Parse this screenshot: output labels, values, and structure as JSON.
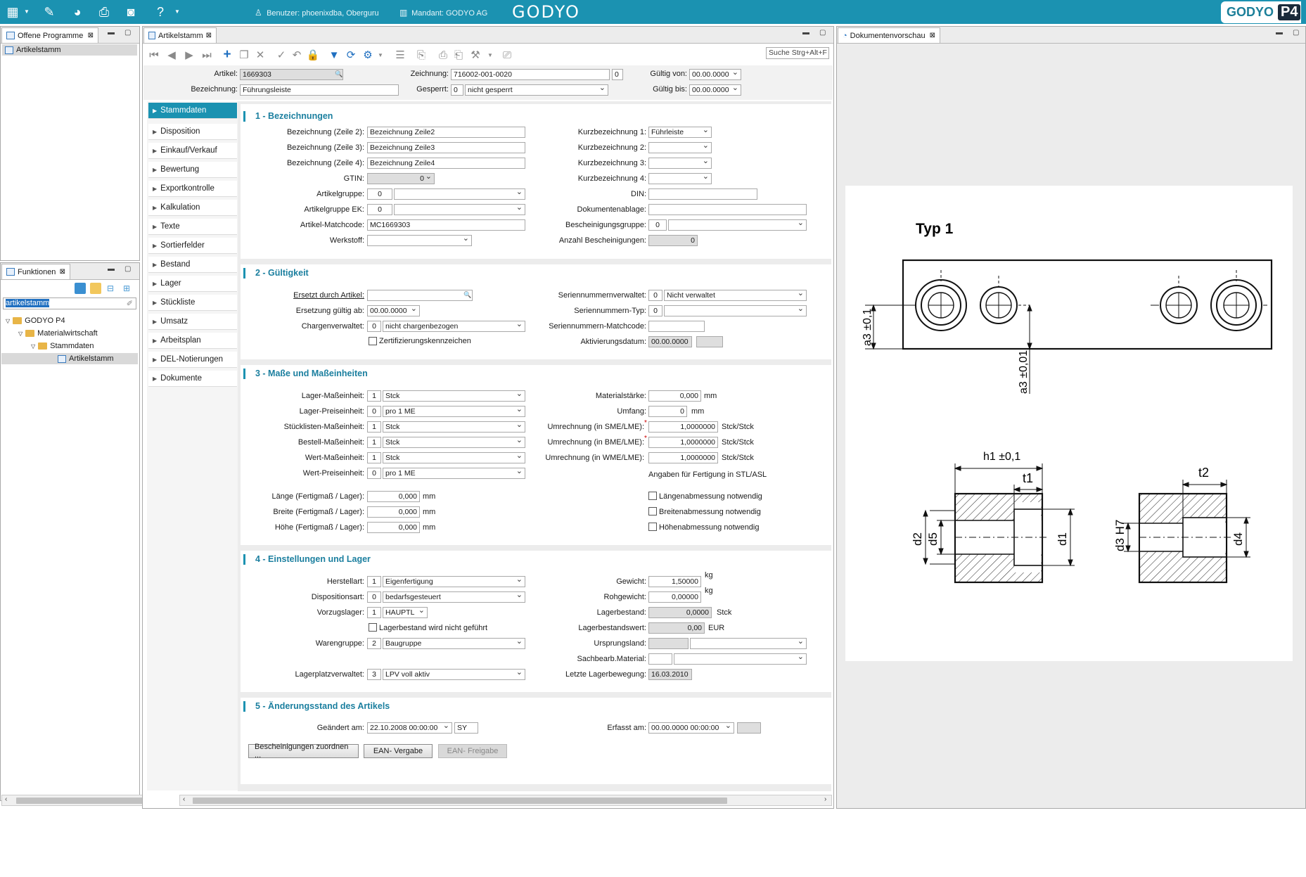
{
  "topbar": {
    "user_label": "Benutzer: phoenixdba, Oberguru",
    "client_label": "Mandant: GODYO AG",
    "logo_center": "GODYO",
    "logo_right": "GODYO",
    "logo_p4": "P4"
  },
  "left_panel": {
    "tab": "Offene Programme",
    "items": [
      "Artikelstamm"
    ]
  },
  "functions_panel": {
    "tab": "Funktionen",
    "search_value": "artikelstamm",
    "tree": [
      "GODYO P4",
      "Materialwirtschaft",
      "Stammdaten",
      "Artikelstamm"
    ]
  },
  "main": {
    "tab": "Artikelstamm",
    "search_placeholder": "Suche Strg+Alt+F",
    "header": {
      "artikel_label": "Artikel:",
      "artikel_value": "1669303",
      "bezeichnung_label": "Bezeichnung:",
      "bezeichnung_value": "Führungsleiste",
      "zeichnung_label": "Zeichnung:",
      "zeichnung_value": "716002-001-0020",
      "zeichnung_idx": "0",
      "gesperrt_label": "Gesperrt:",
      "gesperrt_code": "0",
      "gesperrt_value": "nicht gesperrt",
      "gueltig_von_label": "Gültig von:",
      "gueltig_von_value": "00.00.0000",
      "gueltig_bis_label": "Gültig bis:",
      "gueltig_bis_value": "00.00.0000"
    },
    "nav": [
      "Stammdaten",
      "Disposition",
      "Einkauf/Verkauf",
      "Bewertung",
      "Exportkontrolle",
      "Kalkulation",
      "Texte",
      "Sortierfelder",
      "Bestand",
      "Lager",
      "Stückliste",
      "Umsatz",
      "Arbeitsplan",
      "DEL-Notierungen",
      "Dokumente"
    ],
    "s1": {
      "title": "1 - Bezeichnungen",
      "bz2_l": "Bezeichnung (Zeile 2):",
      "bz2_v": "Bezeichnung Zeile2",
      "bz3_l": "Bezeichnung (Zeile 3):",
      "bz3_v": "Bezeichnung Zeile3",
      "bz4_l": "Bezeichnung (Zeile 4):",
      "bz4_v": "Bezeichnung Zeile4",
      "gtin_l": "GTIN:",
      "gtin_v": "0",
      "ag_l": "Artikelgruppe:",
      "ag_v": "0",
      "agek_l": "Artikelgruppe EK:",
      "agek_v": "0",
      "mc_l": "Artikel-Matchcode:",
      "mc_v": "MC1669303",
      "ws_l": "Werkstoff:",
      "kb1_l": "Kurzbezeichnung 1:",
      "kb1_v": "Führleiste",
      "kb2_l": "Kurzbezeichnung 2:",
      "kb3_l": "Kurzbezeichnung 3:",
      "kb4_l": "Kurzbezeichnung 4:",
      "din_l": "DIN:",
      "dok_l": "Dokumentenablage:",
      "bg_l": "Bescheinigungsgruppe:",
      "bg_v": "0",
      "ab_l": "Anzahl Bescheinigungen:",
      "ab_v": "0"
    },
    "s2": {
      "title": "2 - Gültigkeit",
      "ersetzt_l": "Ersetzt durch Artikel:",
      "ersetz_ab_l": "Ersetzung gültig ab:",
      "ersetz_ab_v": "00.00.0000",
      "charge_l": "Chargenverwaltet:",
      "charge_code": "0",
      "charge_v": "nicht chargenbezogen",
      "zert_l": "Zertifizierungskennzeichen",
      "snv_l": "Seriennummernverwaltet:",
      "snv_code": "0",
      "snv_v": "Nicht verwaltet",
      "snt_l": "Seriennummern-Typ:",
      "snt_v": "0",
      "snm_l": "Seriennummern-Matchcode:",
      "akt_l": "Aktivierungsdatum:",
      "akt_v": "00.00.0000"
    },
    "s3": {
      "title": "3 - Maße und Maßeinheiten",
      "lme_l": "Lager-Maßeinheit:",
      "lme_c": "1",
      "lme_v": "Stck",
      "lpe_l": "Lager-Preiseinheit:",
      "lpe_c": "0",
      "lpe_v": "pro 1 ME",
      "sme_l": "Stücklisten-Maßeinheit:",
      "sme_c": "1",
      "sme_v": "Stck",
      "bme_l": "Bestell-Maßeinheit:",
      "bme_c": "1",
      "bme_v": "Stck",
      "wme_l": "Wert-Maßeinheit:",
      "wme_c": "1",
      "wme_v": "Stck",
      "wpe_l": "Wert-Preiseinheit:",
      "wpe_c": "0",
      "wpe_v": "pro 1 ME",
      "laenge_l": "Länge (Fertigmaß / Lager):",
      "laenge_v": "0,000",
      "breite_l": "Breite (Fertigmaß / Lager):",
      "breite_v": "0,000",
      "hoehe_l": "Höhe (Fertigmaß / Lager):",
      "hoehe_v": "0,000",
      "unit_mm": "mm",
      "ms_l": "Materialstärke:",
      "ms_v": "0,000",
      "umf_l": "Umfang:",
      "umf_v": "0",
      "u_sme_l": "Umrechnung (in SME/LME):",
      "u_sme_v": "1,0000000",
      "u_bme_l": "Umrechnung (in BME/LME):",
      "u_bme_v": "1,0000000",
      "u_wme_l": "Umrechnung (in WME/LME):",
      "u_wme_v": "1,0000000",
      "unit_stck": "Stck/Stck",
      "fert_l": "Angaben für Fertigung in STL/ASL",
      "cb1": "Längenabmessung notwendig",
      "cb2": "Breitenabmessung notwendig",
      "cb3": "Höhenabmessung notwendig"
    },
    "s4": {
      "title": "4 - Einstellungen und Lager",
      "ha_l": "Herstellart:",
      "ha_c": "1",
      "ha_v": "Eigenfertigung",
      "da_l": "Dispositionsart:",
      "da_c": "0",
      "da_v": "bedarfsgesteuert",
      "vl_l": "Vorzugslager:",
      "vl_c": "1",
      "vl_v": "HAUPTL",
      "lb_cb": "Lagerbestand wird nicht geführt",
      "wg_l": "Warengruppe:",
      "wg_c": "2",
      "wg_v": "Baugruppe",
      "lpv_l": "Lagerplatzverwaltet:",
      "lpv_c": "3",
      "lpv_v": "LPV voll aktiv",
      "gew_l": "Gewicht:",
      "gew_v": "1,50000",
      "rgew_l": "Rohgewicht:",
      "rgew_v": "0,00000",
      "unit_kg": "kg",
      "lbest_l": "Lagerbestand:",
      "lbest_v": "0,0000",
      "lbest_u": "Stck",
      "lbw_l": "Lagerbestandswert:",
      "lbw_v": "0,00",
      "lbw_u": "EUR",
      "ul_l": "Ursprungsland:",
      "sbm_l": "Sachbearb.Material:",
      "llb_l": "Letzte Lagerbewegung:",
      "llb_v": "16.03.2010"
    },
    "s5": {
      "title": "5 - Änderungsstand des Artikels",
      "geaendert_l": "Geändert am:",
      "geaendert_v": "22.10.2008 00:00:00",
      "geaendert_u": "SY",
      "erfasst_l": "Erfasst am:",
      "erfasst_v": "00.00.0000 00:00:00",
      "btn1": "Bescheinigungen zuordnen ...",
      "btn2": "EAN- Vergabe",
      "btn3": "EAN- Freigabe"
    }
  },
  "preview": {
    "tab": "Dokumentenvorschau",
    "title": "Typ 1",
    "labels": {
      "a3_left": "a3 ±0,1",
      "a3_bottom": "a3 ±0,01",
      "h1": "h1 ±0,1",
      "t1": "t1",
      "t2": "t2",
      "d2": "d2",
      "d5": "d5",
      "d1": "d1",
      "d3": "d3 H7",
      "d4": "d4"
    }
  }
}
